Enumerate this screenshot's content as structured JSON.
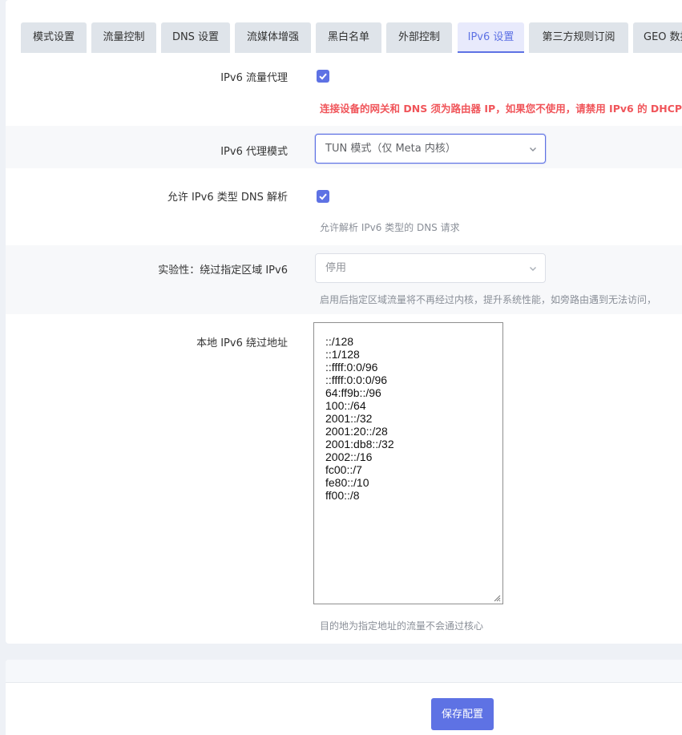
{
  "tabs": [
    {
      "label": "模式设置"
    },
    {
      "label": "流量控制"
    },
    {
      "label": "DNS 设置"
    },
    {
      "label": "流媒体增强"
    },
    {
      "label": "黑白名单"
    },
    {
      "label": "外部控制"
    },
    {
      "label": "IPv6 设置"
    },
    {
      "label": "第三方规则订阅"
    },
    {
      "label": "GEO 数据"
    }
  ],
  "active_tab": "IPv6 设置",
  "form": {
    "ipv6_proxy": {
      "label": "IPv6 流量代理",
      "checked": true,
      "warning": "连接设备的网关和 DNS 须为路由器 IP，如果您不使用，请禁用 IPv6 的 DHCP"
    },
    "ipv6_mode": {
      "label": "IPv6 代理模式",
      "value": "TUN 模式（仅 Meta 内核）"
    },
    "ipv6_dns": {
      "label": "允许 IPv6 类型 DNS 解析",
      "checked": true,
      "hint": "允许解析 IPv6 类型的 DNS 请求"
    },
    "bypass_region": {
      "label": "实验性：绕过指定区域 IPv6",
      "value": "停用",
      "hint": "启用后指定区域流量将不再经过内核，提升系统性能，如旁路由遇到无法访问，"
    },
    "bypass_addresses": {
      "label": "本地 IPv6 绕过地址",
      "lines": [
        "::/128",
        "::1/128",
        "::ffff:0:0/96",
        "::ffff:0:0:0/96",
        "64:ff9b::/96",
        "100::/64",
        "2001::/32",
        "2001:20::/28",
        "2001:db8::/32",
        "2002::/16",
        "fc00::/7",
        "fe80::/10",
        "ff00::/8"
      ],
      "hint": "目的地为指定地址的流量不会通过核心"
    }
  },
  "actions": {
    "save_label": "保存配置"
  },
  "colors": {
    "accent": "#5e72e4",
    "warning": "#f0555a",
    "tab_bg": "#dfe4ea"
  }
}
